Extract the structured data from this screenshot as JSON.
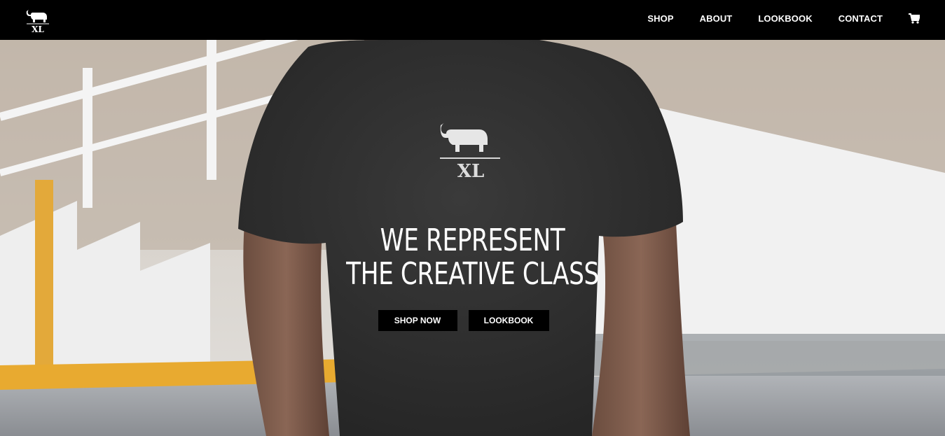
{
  "brand": {
    "logo_text": "XL",
    "logo_icon": "elephant-icon"
  },
  "nav": {
    "items": [
      {
        "label": "SHOP"
      },
      {
        "label": "ABOUT"
      },
      {
        "label": "LOOKBOOK"
      },
      {
        "label": "CONTACT"
      }
    ],
    "cart_icon": "cart-icon"
  },
  "hero": {
    "headline_line1": "WE REPRESENT",
    "headline_line2": "THE CREATIVE CLASS",
    "shirt_logo_text": "XL",
    "buttons": {
      "shop_now": "SHOP NOW",
      "lookbook": "LOOKBOOK"
    }
  },
  "colors": {
    "nav_bg": "#000000",
    "nav_text": "#ffffff",
    "button_bg": "#000000",
    "button_text": "#ffffff"
  }
}
